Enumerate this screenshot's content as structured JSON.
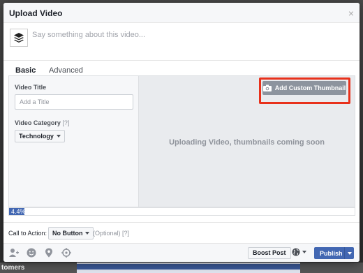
{
  "modal": {
    "title": "Upload Video",
    "close_glyph": "×"
  },
  "composer": {
    "placeholder": "Say something about this video..."
  },
  "tabs": [
    {
      "label": "Basic",
      "active": true
    },
    {
      "label": "Advanced",
      "active": false
    }
  ],
  "form": {
    "video_title_label": "Video Title",
    "video_title_placeholder": "Add a Title",
    "category_label": "Video Category",
    "category_help": "[?]",
    "category_value": "Technology"
  },
  "preview": {
    "thumbnail_button": "Add Custom Thumbnail",
    "uploading_text": "Uploading Video, thumbnails coming soon"
  },
  "progress": {
    "label": "4.4%",
    "value": 0.044
  },
  "cta": {
    "label": "Call to Action:",
    "value": "No Button",
    "optional": "(Optional)",
    "help": "[?]"
  },
  "footer": {
    "icons": [
      "tag-people-icon",
      "feeling-icon",
      "location-icon",
      "target-icon"
    ],
    "boost_label": "Boost Post",
    "audience_icon": "globe-icon",
    "publish_label": "Publish"
  },
  "background": {
    "partial_text": "tomers"
  },
  "colors": {
    "accent": "#4267b2",
    "highlight": "#e8311b"
  }
}
